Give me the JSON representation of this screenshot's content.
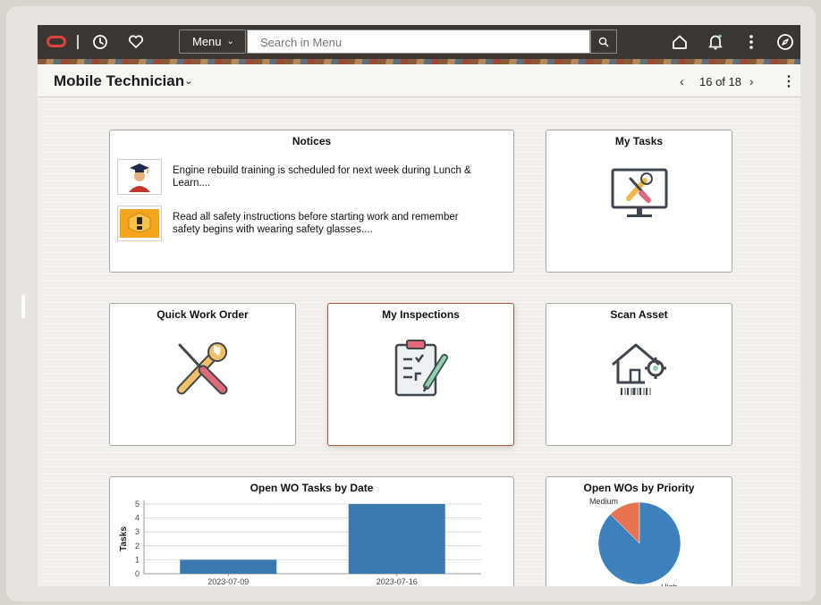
{
  "topbar": {
    "menu_label": "Menu",
    "search_placeholder": "Search in Menu"
  },
  "titlebar": {
    "title": "Mobile Technician",
    "pager": "16 of 18"
  },
  "tiles": {
    "notices": {
      "title": "Notices",
      "items": [
        {
          "text": "Engine rebuild training is scheduled for next week during Lunch & Learn....",
          "icon": "graduate-icon"
        },
        {
          "text": "Read all safety instructions before starting work and remember safety begins with wearing safety glasses....",
          "icon": "safety-warning-icon"
        }
      ]
    },
    "my_tasks": {
      "title": "My Tasks",
      "icon": "monitor-tools-icon"
    },
    "quick_work_order": {
      "title": "Quick Work Order",
      "icon": "wrench-screwdriver-icon"
    },
    "my_inspections": {
      "title": "My Inspections",
      "icon": "clipboard-checklist-icon"
    },
    "scan_asset": {
      "title": "Scan Asset",
      "icon": "house-gear-barcode-icon"
    },
    "open_wo_tasks": {
      "title": "Open WO Tasks by Date"
    },
    "open_wos_priority": {
      "title": "Open WOs by Priority"
    }
  },
  "colors": {
    "topbar": "#3b3632",
    "bar": "#3a78b0",
    "pie_main": "#3d82bd",
    "pie_medium": "#e5744f"
  },
  "chart_data": [
    {
      "type": "bar",
      "title": "Open WO Tasks by Date",
      "ylabel": "Tasks",
      "categories": [
        "2023-07-09",
        "2023-07-16"
      ],
      "values": [
        1,
        5
      ],
      "ylim": [
        0,
        5
      ],
      "yticks": [
        "0",
        "1",
        "2",
        "3",
        "4",
        "5"
      ],
      "grid": true
    },
    {
      "type": "pie",
      "title": "Open WOs by Priority",
      "labels": [
        "Medium",
        "High"
      ],
      "values": [
        1,
        7
      ]
    }
  ]
}
